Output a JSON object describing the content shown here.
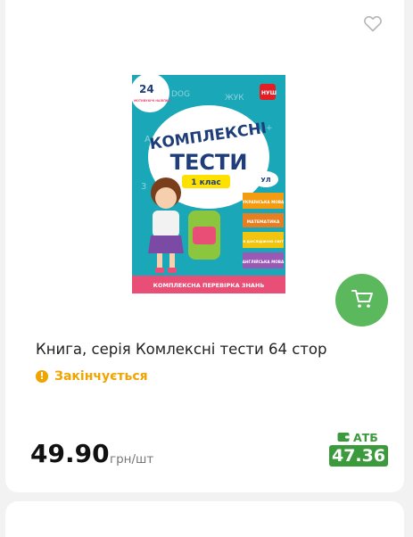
{
  "product": {
    "title": "Книга, серія Комлексні тести 64 стор",
    "stock_status": "Закінчується",
    "price": "49.90",
    "unit": "грн/шт",
    "store_name": "АТБ",
    "store_price": "47.36"
  },
  "cover": {
    "badge_number": "24",
    "badge_text": "МОТИВУЮЧІ НАЛІПКИ",
    "line1": "КОМПЛЕКСНІ",
    "line2": "ТЕСТИ",
    "grade": "1 клас",
    "brand": "УЛ",
    "nush": "НУШ",
    "subjects": [
      "УКРАЇНСЬКА МОВА",
      "МАТЕМАТИКА",
      "Я ДОСЛІДЖУЮ СВІТ",
      "АНГЛІЙСЬКА МОВА"
    ],
    "footer": "КОМПЛЕКСНА ПЕРЕВІРКА ЗНАНЬ",
    "doodle_dog": "DOG",
    "doodle_zhuk": "ЖУК"
  },
  "colors": {
    "accent_green": "#5cb85c",
    "store_green": "#3b9a3b",
    "warning": "#f0a400",
    "cover_teal": "#1aa7b8"
  },
  "icons": {
    "favorite": "heart-outline-icon",
    "cart": "cart-icon",
    "stock": "exclamation-icon",
    "store": "wallet-icon"
  }
}
